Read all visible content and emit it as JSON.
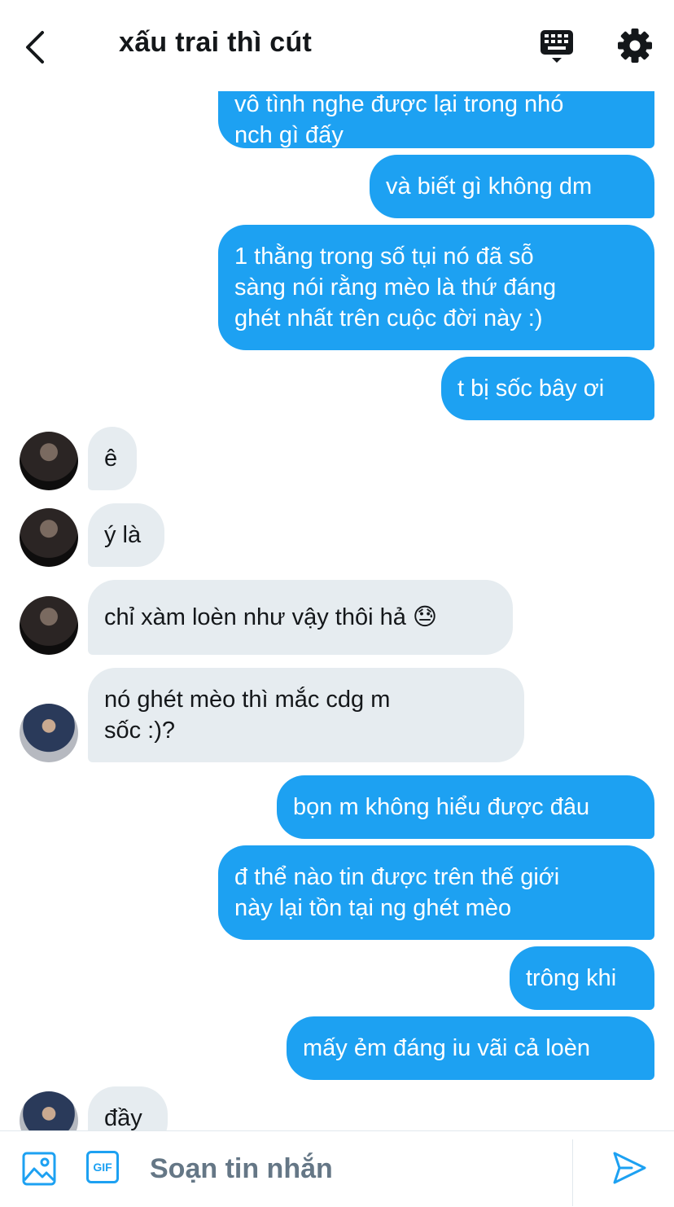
{
  "header": {
    "title": "xấu trai thì cút",
    "back_icon": "chevron-left-icon",
    "keyboard_icon": "keyboard-icon",
    "settings_icon": "gear-icon"
  },
  "messages": [
    {
      "side": "out",
      "text": "vô tình nghe được lại trong nhó\nnch gì đấy"
    },
    {
      "side": "out",
      "text": "và biết gì không dm"
    },
    {
      "side": "out",
      "text": "1 thằng trong số tụi nó đã sỗ\nsàng nói rằng mèo là thứ đáng\nghét nhất trên cuộc đời này :)"
    },
    {
      "side": "out",
      "text": "t bị sốc bây ơi"
    },
    {
      "side": "in",
      "text": "ê"
    },
    {
      "side": "in",
      "text": "ý là"
    },
    {
      "side": "in",
      "text": "chỉ xàm loèn như vậy thôi hả 😓"
    },
    {
      "side": "in",
      "text": "nó ghét mèo thì mắc cdg m\nsốc :)?"
    },
    {
      "side": "out",
      "text": "bọn m không hiểu được đâu"
    },
    {
      "side": "out",
      "text": "đ thể nào tin được trên thế giới\nnày lại tồn tại ng ghét mèo"
    },
    {
      "side": "out",
      "text": "trông khi"
    },
    {
      "side": "out",
      "text": "mấy ẻm đáng iu vãi cả loèn"
    },
    {
      "side": "in",
      "text": "đầy"
    }
  ],
  "composer": {
    "placeholder": "Soạn tin nhắn",
    "image_icon": "image-icon",
    "gif_label": "GIF",
    "send_icon": "send-icon"
  },
  "colors": {
    "accent": "#1da1f2",
    "incoming_bubble": "#e6ecf0",
    "placeholder_text": "#657786"
  }
}
